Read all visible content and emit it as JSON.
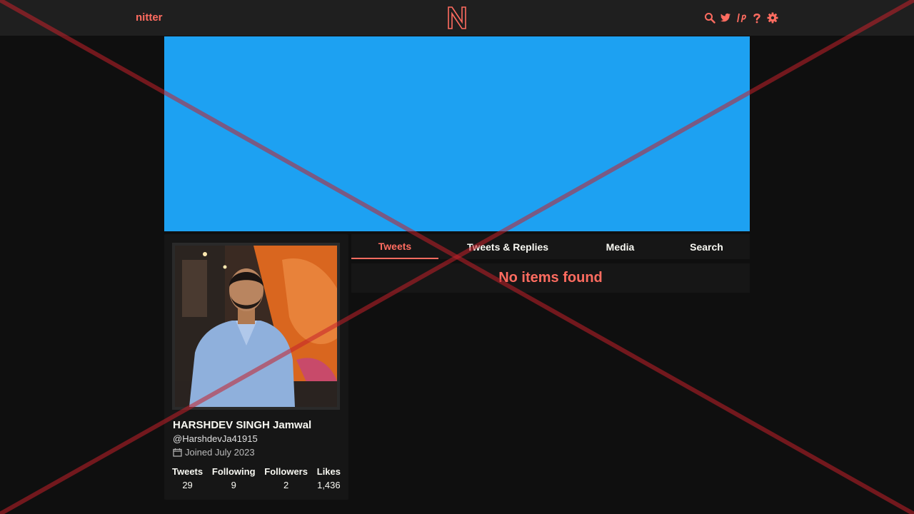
{
  "nav": {
    "brand": "nitter",
    "icons": [
      "search-icon",
      "twitter-bird-icon",
      "rss-icon",
      "help-icon",
      "gear-icon"
    ]
  },
  "colors": {
    "accent": "#ff6c60",
    "background": "#0f0f0f",
    "panel": "#161616",
    "banner": "#1da1f2"
  },
  "profile": {
    "fullname": "HARSHDEV SINGH Jamwal",
    "username": "@HarshdevJa41915",
    "joined": "Joined July 2023",
    "stats": [
      {
        "label": "Tweets",
        "value": "29"
      },
      {
        "label": "Following",
        "value": "9"
      },
      {
        "label": "Followers",
        "value": "2"
      },
      {
        "label": "Likes",
        "value": "1,436"
      }
    ]
  },
  "tabs": [
    {
      "label": "Tweets",
      "active": true
    },
    {
      "label": "Tweets & Replies",
      "active": false
    },
    {
      "label": "Media",
      "active": false
    },
    {
      "label": "Search",
      "active": false
    }
  ],
  "timeline": {
    "empty_message": "No items found"
  }
}
